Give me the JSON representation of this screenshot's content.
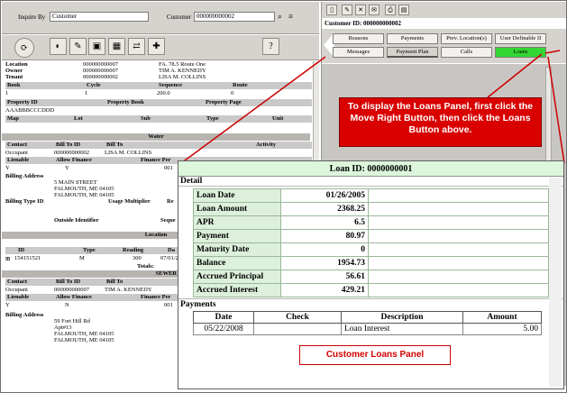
{
  "inquire": {
    "label": "Inquire By",
    "value": "Customer",
    "customer_label": "Customer",
    "customer_value": "000000000002"
  },
  "left": {
    "location_label": "Location",
    "location_value": "000000000007",
    "location_addr": "FA. 78.5 Route One",
    "owner_label": "Owner",
    "owner_value": "000000000007",
    "owner_name": "TIM A. KENNEDY",
    "tenant_label": "Tenant",
    "tenant_value": "000000000002",
    "tenant_name": "LISA M. COLLINS",
    "book_hdr": [
      "Book",
      "Cycle",
      "Sequence",
      "Route"
    ],
    "book_vals": [
      "1",
      "1",
      "200.0",
      "0"
    ],
    "prop_hdr": [
      "Property ID",
      "Property Book",
      "Property Page"
    ],
    "prop_id": "AAABBBCCCDDD",
    "map_hdr": [
      "Map",
      "Lot",
      "Sub",
      "Type",
      "Unit"
    ],
    "water": "Water",
    "contact_hdr": [
      "Contact",
      "Bill To ID",
      "Bill To",
      "Activity"
    ],
    "contact_row": [
      "Occupant",
      "000000000002",
      "LISA M. COLLINS"
    ],
    "lienable_hdr": [
      "Lienable",
      "Allow Finance",
      "Finance Per"
    ],
    "lienable_row": [
      "Y",
      "Y",
      "001"
    ],
    "billing_addr": "Billing Address",
    "addr1": "5 MAIN STREET",
    "addr2": "FALMOUTH, ME 04105",
    "addr3": "FALMOUTH, ME 04105",
    "billing_type": "Billing Type ID",
    "usage_mult": "Usage Multiplier",
    "re": "Re",
    "outside": "Outside Identifier",
    "seq": "Seque",
    "location": "Location",
    "id_hdr": [
      "ID",
      "Type",
      "Reading",
      "Da"
    ],
    "id_row": [
      "154151521",
      "M",
      "300",
      "07/01/2"
    ],
    "totals": "Totals:",
    "sewer": "SEWER",
    "contact2_row": [
      "Occupant",
      "000000000007",
      "TIM A. KENNEDY"
    ],
    "lienable2_row": [
      "Y",
      "N",
      "001"
    ],
    "addr_b1": "59 Fort Hill Rd",
    "addr_b2": "Apt#13",
    "addr_b3": "FALMOUTH, ME 04105",
    "addr_b4": "FALMOUTH, ME 04105"
  },
  "right": {
    "customer_id": "Customer ID: 000000000002",
    "tabs_row1": [
      "Reasons",
      "Payments",
      "Prev. Location(s)",
      "User Definable II"
    ],
    "tabs_row2": [
      "Messages",
      "Payment Plan",
      "Calls",
      "Loans"
    ]
  },
  "note": "To display the Loans Panel, first click the Move Right Button, then click the Loans Button above.",
  "loans": {
    "title": "Loan ID: 0000000001",
    "detail_label": "Detail",
    "details": [
      {
        "k": "Loan Date",
        "v": "01/26/2005"
      },
      {
        "k": "Loan Amount",
        "v": "2368.25"
      },
      {
        "k": "APR",
        "v": "6.5"
      },
      {
        "k": "Payment",
        "v": "80.97"
      },
      {
        "k": "Maturity Date",
        "v": "0"
      },
      {
        "k": "Balance",
        "v": "1954.73"
      },
      {
        "k": "Accrued Principal",
        "v": "56.61"
      },
      {
        "k": "Accrued Interest",
        "v": "429.21"
      }
    ],
    "payments_label": "Payments",
    "pay_headers": [
      "Date",
      "Check",
      "Description",
      "Amount"
    ],
    "pay_rows": [
      {
        "date": "05/22/2008",
        "check": "",
        "desc": "Loan Interest",
        "amount": "5.00"
      }
    ],
    "panel_caption": "Customer Loans Panel"
  },
  "colors": {
    "accent_green": "#33d633",
    "note_red": "#d90000"
  }
}
